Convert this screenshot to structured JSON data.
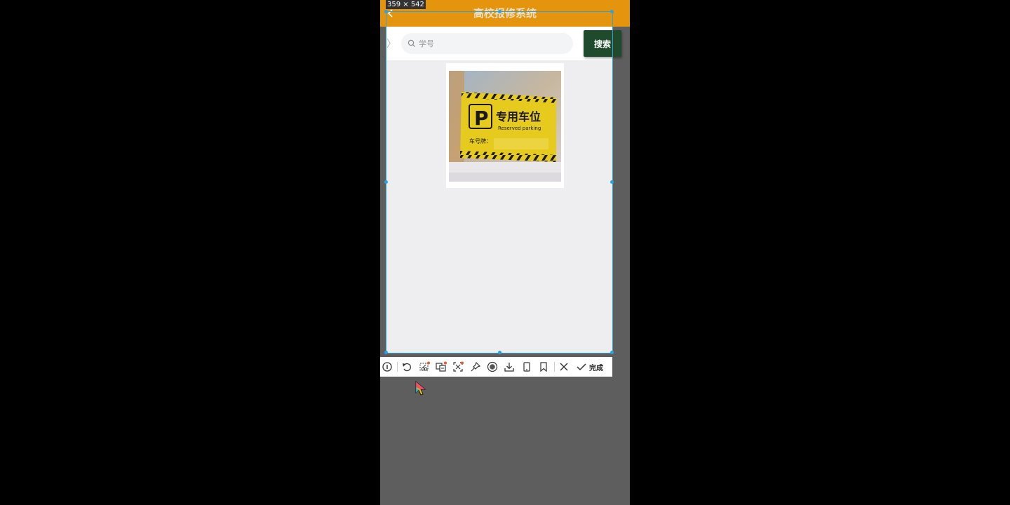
{
  "app": {
    "title": "高校报修系统"
  },
  "search": {
    "placeholder": "学号",
    "button_label": "搜索"
  },
  "result_photo": {
    "sign_main": "专用车位",
    "sign_sub": "Reserved parking",
    "sign_field": "车号牌：",
    "sign_letter": "P"
  },
  "capture": {
    "size_label": "359 × 542",
    "done_label": "完成"
  },
  "colors": {
    "header": "#e4940d",
    "search_button": "#1f4a2c",
    "selection": "#29a3e6",
    "sign_yellow": "#e6cb1e"
  }
}
